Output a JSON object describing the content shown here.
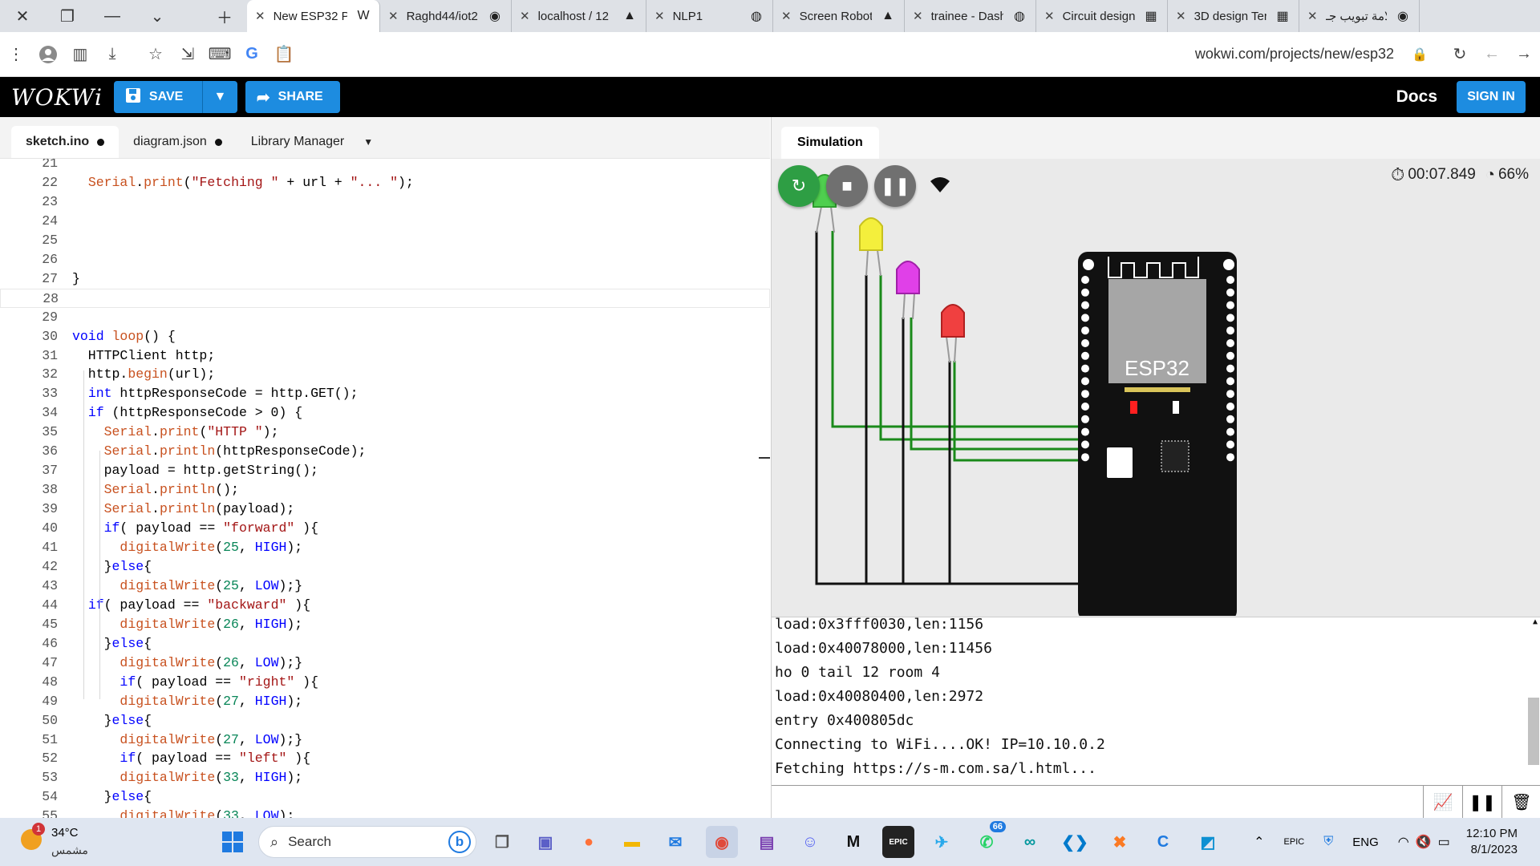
{
  "browser": {
    "tabs": [
      {
        "label": "New ESP32 Pr",
        "icon": "wokwi-icon",
        "active": true
      },
      {
        "label": "Raghd44/iot2",
        "icon": "github-icon"
      },
      {
        "label": "localhost / 12",
        "icon": "phpmyadmin-icon"
      },
      {
        "label": "NLP1",
        "icon": "globe-icon"
      },
      {
        "label": "Screen Robot",
        "icon": "drive-icon"
      },
      {
        "label": "trainee - Dash",
        "icon": "globe-icon"
      },
      {
        "label": "Circuit design",
        "icon": "tinkercad-icon"
      },
      {
        "label": "3D design Ter",
        "icon": "tinkercad-icon"
      },
      {
        "label": "علامة تبويب جـ",
        "icon": "chrome-icon"
      }
    ],
    "url": "wokwi.com/projects/new/esp32"
  },
  "wokwi": {
    "logo": "WOKWi",
    "save_label": "SAVE",
    "share_label": "SHARE",
    "docs_label": "Docs",
    "signin_label": "SIGN IN"
  },
  "editor": {
    "tabs": [
      {
        "label": "sketch.ino",
        "modified": true
      },
      {
        "label": "diagram.json",
        "modified": true
      },
      {
        "label": "Library Manager"
      }
    ],
    "lines": [
      {
        "n": "21",
        "t": ""
      },
      {
        "n": "22",
        "t": "  Serial.print(\"Fetching \" + url + \"... \");"
      },
      {
        "n": "23",
        "t": ""
      },
      {
        "n": "24",
        "t": ""
      },
      {
        "n": "25",
        "t": ""
      },
      {
        "n": "26",
        "t": ""
      },
      {
        "n": "27",
        "t": "}"
      },
      {
        "n": "28",
        "t": ""
      },
      {
        "n": "29",
        "t": ""
      },
      {
        "n": "30",
        "t": "void loop() {"
      },
      {
        "n": "31",
        "t": "  HTTPClient http;"
      },
      {
        "n": "32",
        "t": "  http.begin(url);"
      },
      {
        "n": "33",
        "t": "  int httpResponseCode = http.GET();"
      },
      {
        "n": "34",
        "t": "  if (httpResponseCode > 0) {"
      },
      {
        "n": "35",
        "t": "    Serial.print(\"HTTP \");"
      },
      {
        "n": "36",
        "t": "    Serial.println(httpResponseCode);"
      },
      {
        "n": "37",
        "t": "    payload = http.getString();"
      },
      {
        "n": "38",
        "t": "    Serial.println();"
      },
      {
        "n": "39",
        "t": "    Serial.println(payload);"
      },
      {
        "n": "40",
        "t": "    if( payload == \"forward\" ){"
      },
      {
        "n": "41",
        "t": "      digitalWrite(25, HIGH);"
      },
      {
        "n": "42",
        "t": "    }else{"
      },
      {
        "n": "43",
        "t": "      digitalWrite(25, LOW);}"
      },
      {
        "n": "44",
        "t": "  if( payload == \"backward\" ){"
      },
      {
        "n": "45",
        "t": "      digitalWrite(26, HIGH);"
      },
      {
        "n": "46",
        "t": "    }else{"
      },
      {
        "n": "47",
        "t": "      digitalWrite(26, LOW);}"
      },
      {
        "n": "48",
        "t": "      if( payload == \"right\" ){"
      },
      {
        "n": "49",
        "t": "      digitalWrite(27, HIGH);"
      },
      {
        "n": "50",
        "t": "    }else{"
      },
      {
        "n": "51",
        "t": "      digitalWrite(27, LOW);}"
      },
      {
        "n": "52",
        "t": "      if( payload == \"left\" ){"
      },
      {
        "n": "53",
        "t": "      digitalWrite(33, HIGH);"
      },
      {
        "n": "54",
        "t": "    }else{"
      },
      {
        "n": "55",
        "t": "      digitalWrite(33, LOW);"
      }
    ],
    "current_line": "28"
  },
  "simulation": {
    "tab_label": "Simulation",
    "timer": "00:07.849",
    "speed": "66%",
    "chip_label": "ESP32",
    "leds": [
      "green",
      "yellow",
      "magenta",
      "red"
    ],
    "serial_lines": [
      "load:0x3fff0030,len:1156",
      "load:0x40078000,len:11456",
      "ho 0 tail 12 room 4",
      "load:0x40080400,len:2972",
      "entry 0x400805dc",
      "Connecting to WiFi....OK! IP=10.10.0.2",
      "Fetching https://s-m.com.sa/l.html..."
    ]
  },
  "taskbar": {
    "temp": "34°C",
    "weather_label": "مشمس",
    "weather_badge": "1",
    "search_placeholder": "Search",
    "whatsapp_badge": "66",
    "lang": "ENG",
    "time": "12:10 PM",
    "date": "8/1/2023"
  },
  "colors": {
    "accent": "#1d8ce0",
    "restart": "#2e9e44",
    "stop": "#707070",
    "wire": "#1a8a1a"
  }
}
